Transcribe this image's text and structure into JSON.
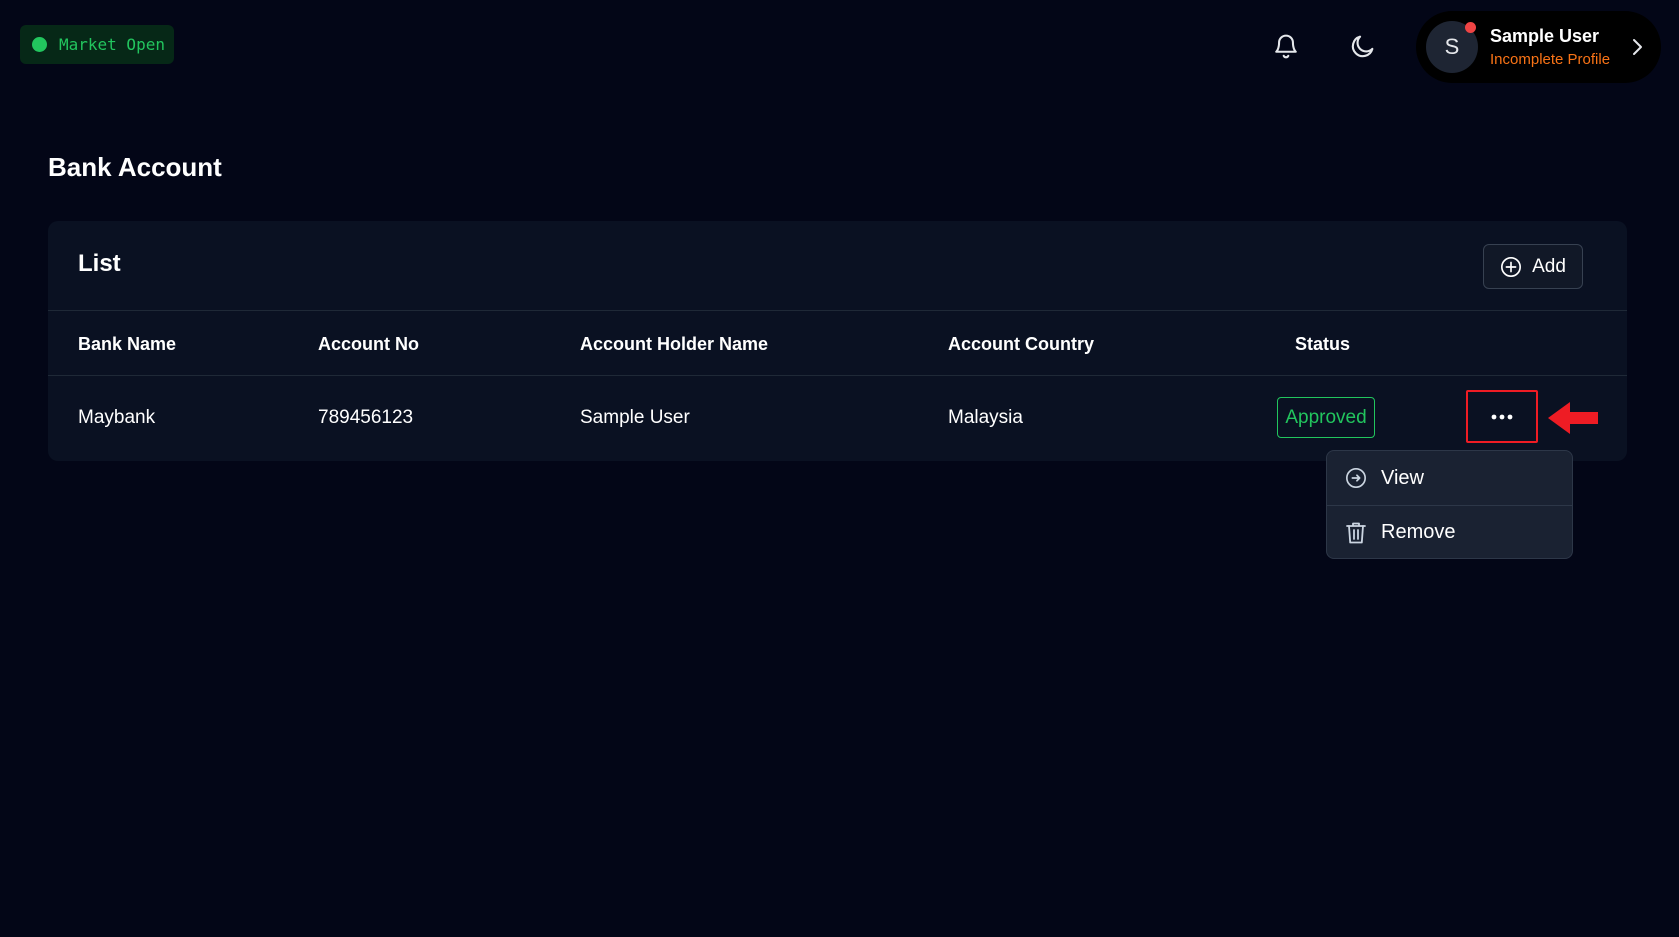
{
  "header": {
    "market_status": "Market Open",
    "user": {
      "initial": "S",
      "name": "Sample User",
      "subtitle": "Incomplete Profile"
    }
  },
  "page": {
    "title": "Bank Account"
  },
  "list": {
    "title": "List",
    "add_label": "Add",
    "columns": [
      "Bank Name",
      "Account No",
      "Account Holder Name",
      "Account Country",
      "Status"
    ],
    "rows": [
      {
        "bank_name": "Maybank",
        "account_no": "789456123",
        "holder_name": "Sample User",
        "country": "Malaysia",
        "status": "Approved"
      }
    ]
  },
  "menu": {
    "items": [
      {
        "label": "View",
        "icon": "arrow-circle-right-icon"
      },
      {
        "label": "Remove",
        "icon": "trash-icon"
      }
    ]
  },
  "colors": {
    "background": "#030617",
    "card": "#0a1122",
    "success": "#22c55e",
    "warning": "#f97316",
    "highlight": "#ef1c24"
  }
}
